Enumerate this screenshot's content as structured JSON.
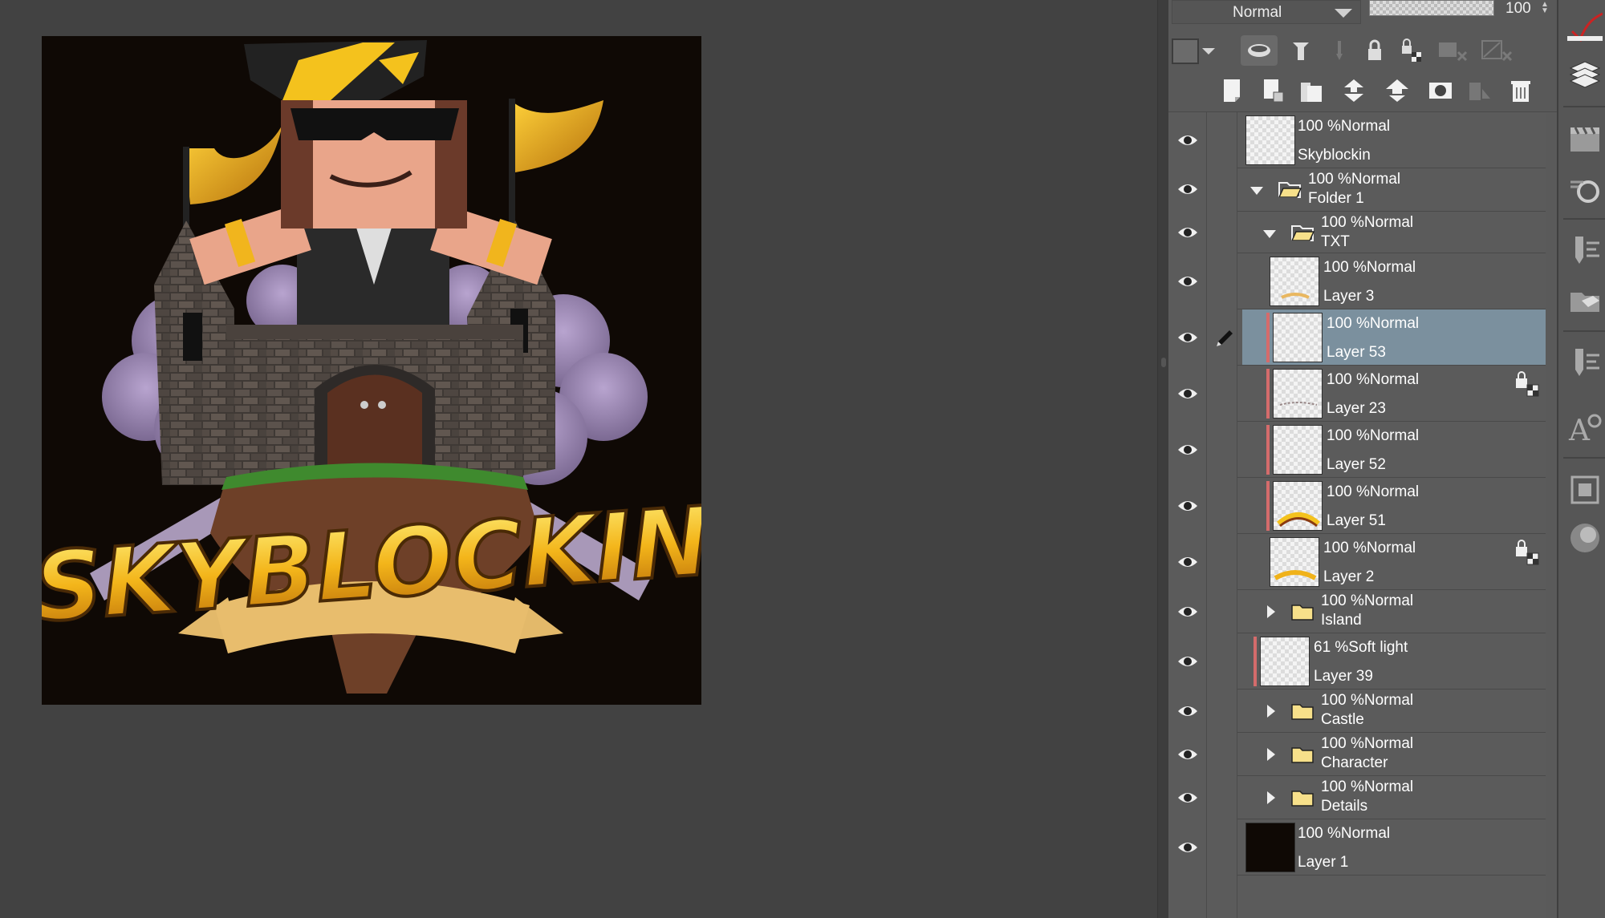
{
  "artwork": {
    "title_text": "SKYBLOCKIN"
  },
  "layer_panel": {
    "blend_mode": "Normal",
    "opacity_value": "100",
    "layers": [
      {
        "opacity_mode": "100 %Normal",
        "name": "Skyblockin"
      },
      {
        "opacity_mode": "100 %Normal",
        "name": "Folder 1"
      },
      {
        "opacity_mode": "100 %Normal",
        "name": "TXT"
      },
      {
        "opacity_mode": "100 %Normal",
        "name": "Layer 3"
      },
      {
        "opacity_mode": "100 %Normal",
        "name": "Layer 53"
      },
      {
        "opacity_mode": "100 %Normal",
        "name": "Layer 23"
      },
      {
        "opacity_mode": "100 %Normal",
        "name": "Layer 52"
      },
      {
        "opacity_mode": "100 %Normal",
        "name": "Layer 51"
      },
      {
        "opacity_mode": "100 %Normal",
        "name": "Layer 2"
      },
      {
        "opacity_mode": "100 %Normal",
        "name": "Island"
      },
      {
        "opacity_mode": "61 %Soft light",
        "name": "Layer 39"
      },
      {
        "opacity_mode": "100 %Normal",
        "name": "Castle"
      },
      {
        "opacity_mode": "100 %Normal",
        "name": "Character"
      },
      {
        "opacity_mode": "100 %Normal",
        "name": "Details"
      },
      {
        "opacity_mode": "100 %Normal",
        "name": "Layer 1"
      }
    ],
    "selected_layer": "Layer 53"
  },
  "colors": {
    "canvas_bg": "#424242",
    "panel_bg": "#5a5a5a",
    "selected_row": "#7b909e",
    "artwork_bg": "#0f0905",
    "accent_red": "#d46b6b"
  },
  "icons": {
    "visibility": "eye-icon",
    "folder": "folder-icon",
    "lock": "lock-icon",
    "pen": "pencil-icon"
  }
}
